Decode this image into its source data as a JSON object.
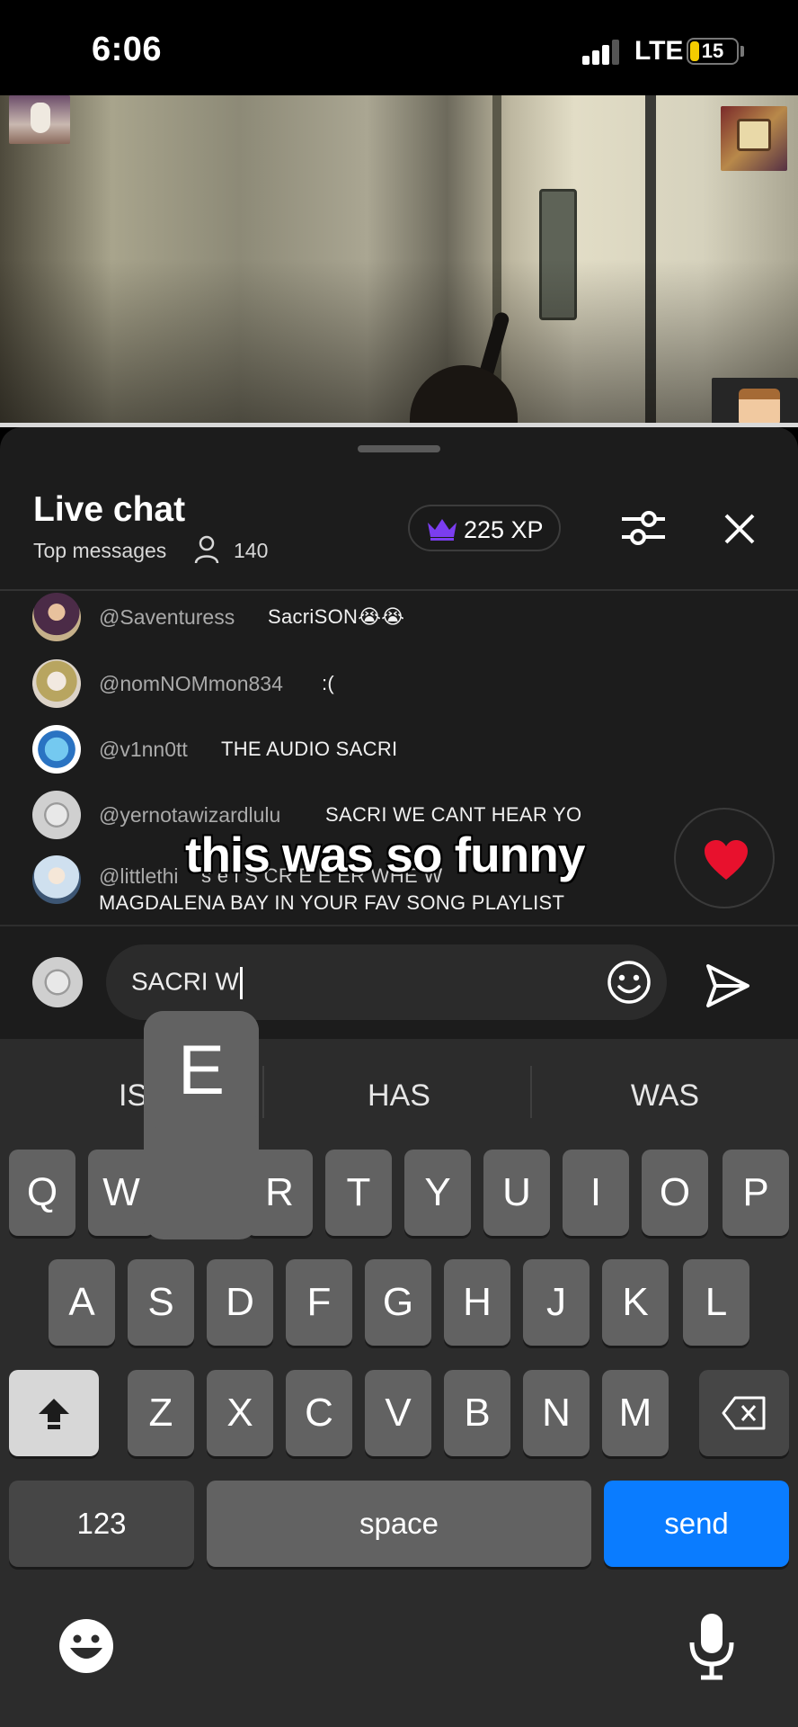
{
  "status_bar": {
    "time": "6:06",
    "network": "LTE",
    "battery": "15"
  },
  "chat": {
    "title": "Live chat",
    "mode": "Top messages",
    "viewer_count": "140",
    "xp": "225 XP",
    "messages": [
      {
        "author": "@Saventuress",
        "text": "SacriSON😭😭"
      },
      {
        "author": "@nomNOMmon834",
        "text": ":("
      },
      {
        "author": "@v1nn0tt",
        "text": "THE AUDIO SACRI"
      },
      {
        "author": "@yernotawizardlulu",
        "text": "SACRI WE CANT HEAR YO"
      },
      {
        "author": "@littlethi",
        "text": "s  e    i S CR  E  E ER WHE   W",
        "text2": "MAGDALENA BAY IN YOUR FAV SONG PLAYLIST"
      }
    ],
    "reaction": "❤️"
  },
  "overlay_caption": "this was so funny",
  "input": {
    "value": "SACRI W"
  },
  "keyboard": {
    "suggestions": [
      "IS",
      "HAS",
      "WAS"
    ],
    "popup_letter": "E",
    "row1": [
      "Q",
      "W",
      "E",
      "R",
      "T",
      "Y",
      "U",
      "I",
      "O",
      "P"
    ],
    "row2": [
      "A",
      "S",
      "D",
      "F",
      "G",
      "H",
      "J",
      "K",
      "L"
    ],
    "row3": [
      "Z",
      "X",
      "C",
      "V",
      "B",
      "N",
      "M"
    ],
    "numbers_label": "123",
    "space_label": "space",
    "send_label": "send"
  },
  "colors": {
    "send_key": "#0a7cff",
    "battery_fill": "#f5cc00",
    "crown": "#7b3df0"
  }
}
